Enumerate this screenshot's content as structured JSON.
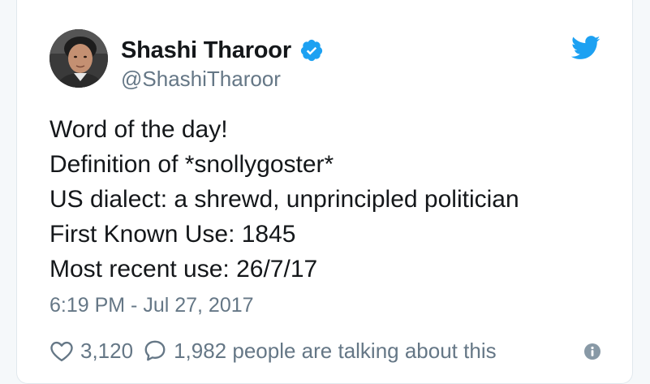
{
  "author": {
    "display_name": "Shashi Tharoor",
    "handle": "@ShashiTharoor",
    "verified": true
  },
  "tweet": {
    "lines": [
      "Word of the day!",
      "Definition of *snollygoster*",
      "US dialect: a shrewd, unprincipled politician",
      "First Known Use: 1845",
      "Most recent use: 26/7/17"
    ],
    "timestamp": "6:19 PM - Jul 27, 2017"
  },
  "engagement": {
    "likes": "3,120",
    "talking": "1,982 people are talking about this"
  },
  "icons": {
    "like": "heart-icon",
    "reply": "speech-bubble-icon",
    "brand": "twitter-bird-icon",
    "verified": "verified-badge-icon",
    "info": "info-icon"
  },
  "colors": {
    "brand_blue": "#1da1f2",
    "text_primary": "#14171a",
    "text_secondary": "#657786",
    "info_gray": "#8899a6"
  }
}
